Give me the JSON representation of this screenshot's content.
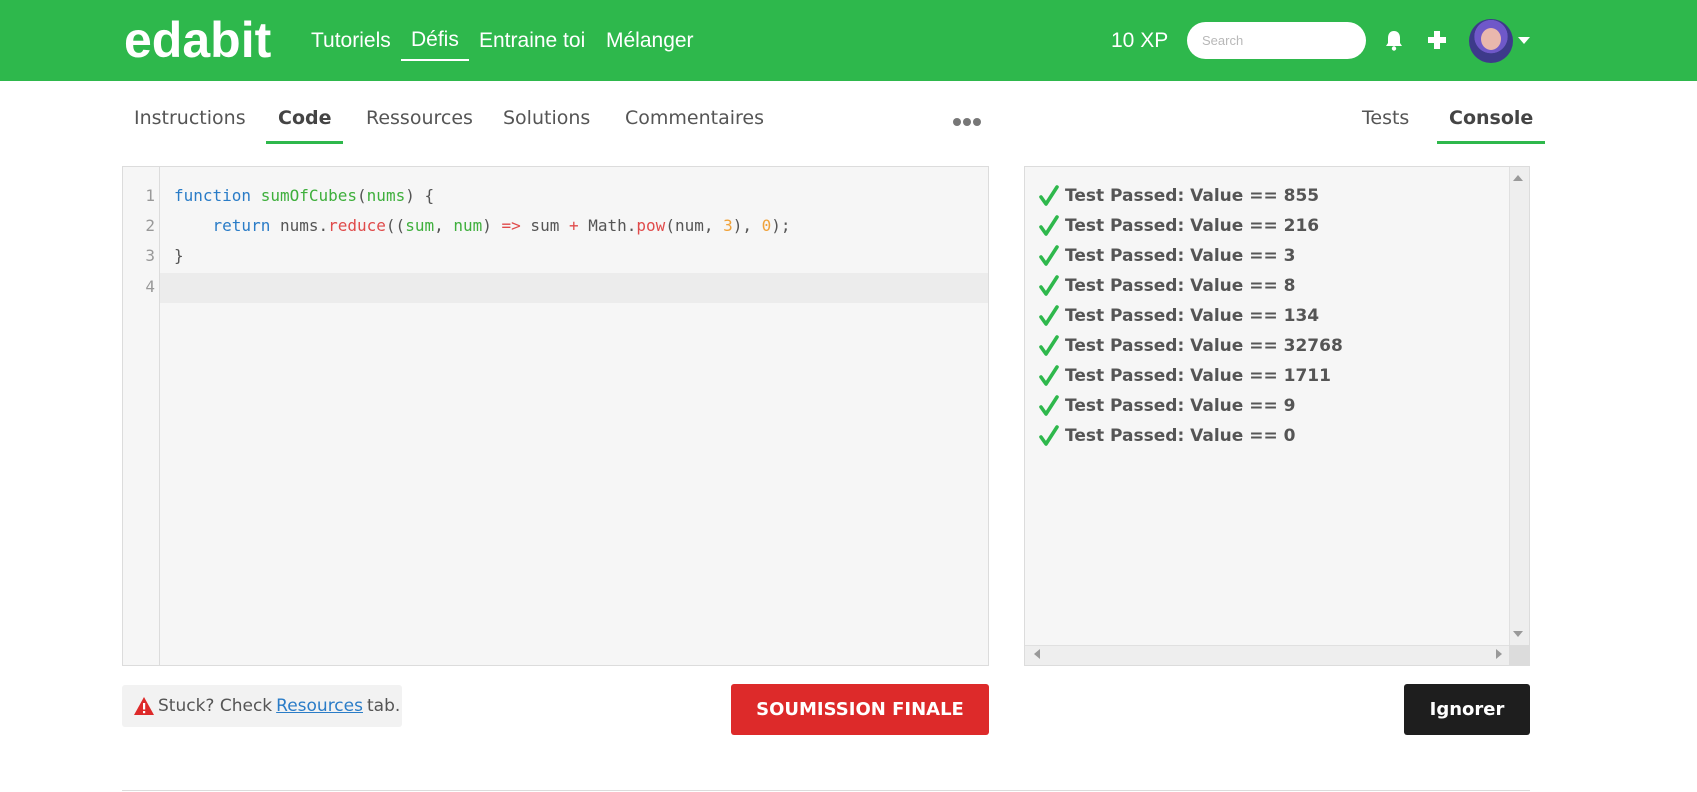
{
  "header": {
    "logo": "edabit",
    "nav": [
      {
        "label": "Tutoriels"
      },
      {
        "label": "Défis",
        "active": true
      },
      {
        "label": "Entraine toi"
      },
      {
        "label": "Mélanger"
      }
    ],
    "xp": "10 XP",
    "search_placeholder": "Search",
    "icons": [
      "bell-icon",
      "plus-icon",
      "avatar",
      "caret-down-icon"
    ]
  },
  "tabs_left": [
    {
      "label": "Instructions"
    },
    {
      "label": "Code",
      "active": true
    },
    {
      "label": "Ressources"
    },
    {
      "label": "Solutions"
    },
    {
      "label": "Commentaires"
    }
  ],
  "tabs_right": [
    {
      "label": "Tests"
    },
    {
      "label": "Console",
      "active": true
    }
  ],
  "editor": {
    "line_numbers": [
      "1",
      "2",
      "3",
      "4"
    ],
    "lines": [
      "function sumOfCubes(nums) {",
      "    return nums.reduce((sum, num) => sum + Math.pow(num, 3), 0);",
      "}",
      ""
    ]
  },
  "console": {
    "results": [
      "Test Passed: Value == 855",
      "Test Passed: Value == 216",
      "Test Passed: Value == 3",
      "Test Passed: Value == 8",
      "Test Passed: Value == 134",
      "Test Passed: Value == 32768",
      "Test Passed: Value == 1711",
      "Test Passed: Value == 9",
      "Test Passed: Value == 0"
    ]
  },
  "footer": {
    "stuck_prefix": "Stuck? Check",
    "stuck_link": "Resources",
    "stuck_suffix": "tab.",
    "submit_label": "SOUMISSION FINALE",
    "ignore_label": "Ignorer"
  },
  "colors": {
    "brand_green": "#2eb84c",
    "submit_red": "#dd2a2a",
    "ignore_black": "#1e1e1e"
  }
}
